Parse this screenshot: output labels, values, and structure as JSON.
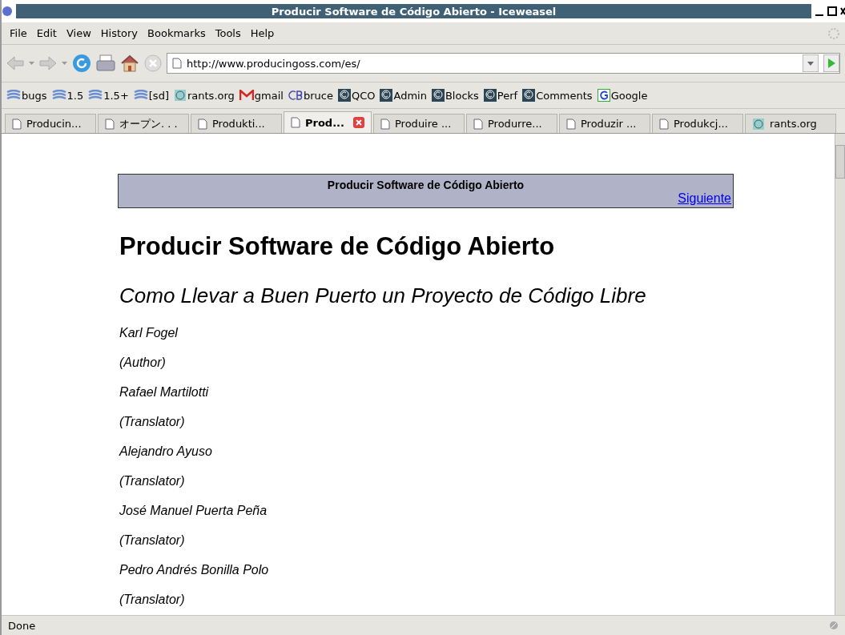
{
  "window": {
    "title": "Producir Software de Código Abierto - Iceweasel"
  },
  "menu": [
    "File",
    "Edit",
    "View",
    "History",
    "Bookmarks",
    "Tools",
    "Help"
  ],
  "address": {
    "value": "http://www.producingoss.com/es/"
  },
  "bookmarks": [
    {
      "label": "bugs",
      "kind": "bugzilla"
    },
    {
      "label": "1.5",
      "kind": "bugzilla"
    },
    {
      "label": "1.5+",
      "kind": "bugzilla"
    },
    {
      "label": "[sd]",
      "kind": "bugzilla"
    },
    {
      "label": "rants.org",
      "kind": "globe"
    },
    {
      "label": "gmail",
      "kind": "mail"
    },
    {
      "label": "bruce",
      "kind": "cb"
    },
    {
      "label": "QCO",
      "kind": "copyright"
    },
    {
      "label": "Admin",
      "kind": "copyright"
    },
    {
      "label": "Blocks",
      "kind": "copyright"
    },
    {
      "label": "Perf",
      "kind": "copyright"
    },
    {
      "label": "Comments",
      "kind": "copyright"
    },
    {
      "label": "Google",
      "kind": "google"
    }
  ],
  "tabs": [
    {
      "label": "Producin...",
      "selected": false,
      "kind": "page"
    },
    {
      "label": "オープン. . .",
      "selected": false,
      "kind": "page"
    },
    {
      "label": "Produkti...",
      "selected": false,
      "kind": "page"
    },
    {
      "label": "Prod...",
      "selected": true,
      "kind": "page"
    },
    {
      "label": "Produire ...",
      "selected": false,
      "kind": "page"
    },
    {
      "label": "Produrre...",
      "selected": false,
      "kind": "page"
    },
    {
      "label": "Produzir ...",
      "selected": false,
      "kind": "page"
    },
    {
      "label": "Produkcj...",
      "selected": false,
      "kind": "page"
    },
    {
      "label": "rants.org",
      "selected": false,
      "kind": "globe"
    }
  ],
  "page": {
    "nav_header": {
      "title": "Producir Software de Código Abierto",
      "next_link": "Siguiente"
    },
    "title": "Producir Software de Código Abierto",
    "subtitle": "Como Llevar a Buen Puerto un Proyecto de Código Libre",
    "credits": [
      "Karl Fogel",
      "(Author)",
      "Rafael Martilotti",
      "(Translator)",
      "Alejandro Ayuso",
      "(Translator)",
      "José Manuel Puerta Peña",
      "(Translator)",
      "Pedro Andrés Bonilla Polo",
      "(Translator)"
    ]
  },
  "status_bar": {
    "text": "Done"
  }
}
